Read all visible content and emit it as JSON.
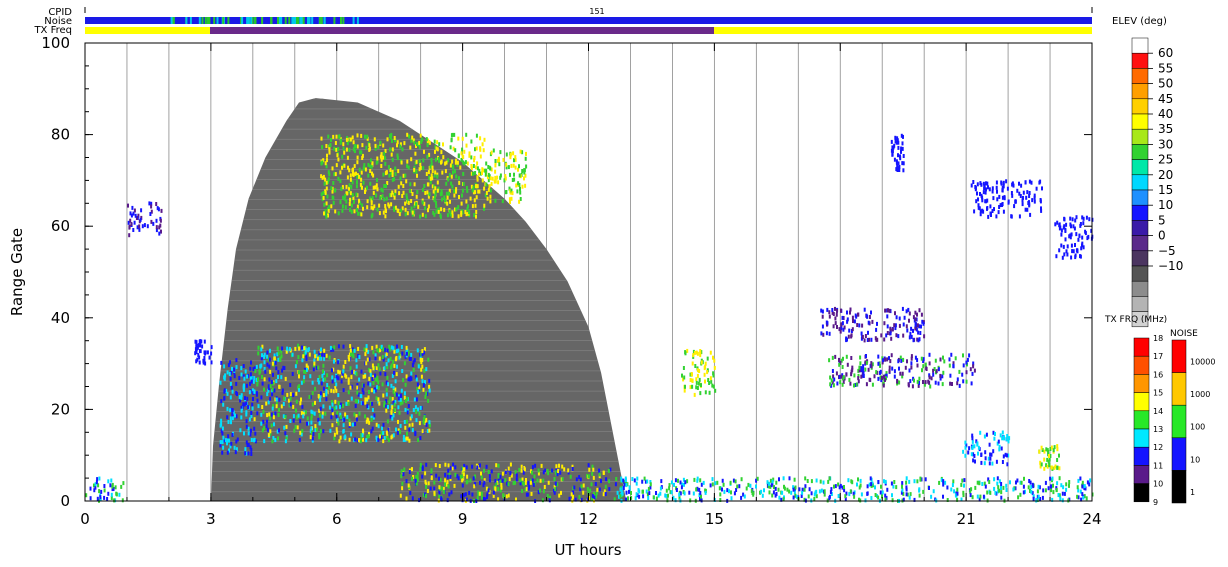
{
  "chart_data": {
    "type": "heatmap",
    "strips": {
      "cpid_label": "CPID",
      "cpid_value": "151",
      "noise_label": "Noise",
      "txfreq_label": "TX Freq",
      "noise_colour": "#1a1ae6",
      "txfreq_colour_default": "#ffff00",
      "txfreq_colour_alt": "#6a2a8a",
      "txfreq_alt_range_hours": [
        3,
        15
      ]
    },
    "xlabel": "UT hours",
    "ylabel": "Range Gate",
    "xlim": [
      0,
      24
    ],
    "ylim": [
      0,
      100
    ],
    "x_ticks": [
      "0",
      "3",
      "6",
      "9",
      "12",
      "15",
      "18",
      "21",
      "24"
    ],
    "x_tick_values": [
      0,
      3,
      6,
      9,
      12,
      15,
      18,
      21,
      24
    ],
    "y_ticks": [
      "0",
      "20",
      "40",
      "60",
      "80",
      "100"
    ],
    "y_tick_values": [
      0,
      20,
      40,
      60,
      80,
      100
    ],
    "vertical_grid_hours": [
      1,
      2,
      3,
      4,
      5,
      6,
      7,
      8,
      9,
      10,
      11,
      12,
      13,
      14,
      15,
      16,
      17,
      18,
      19,
      20,
      21,
      22,
      23
    ],
    "ground_scatter_colour": "#666666",
    "ground_scatter_envelope": [
      [
        3.0,
        0
      ],
      [
        3.05,
        12
      ],
      [
        3.2,
        26
      ],
      [
        3.4,
        42
      ],
      [
        3.6,
        55
      ],
      [
        3.9,
        66
      ],
      [
        4.3,
        75
      ],
      [
        4.8,
        83
      ],
      [
        5.1,
        87
      ],
      [
        5.5,
        88
      ],
      [
        6.0,
        87.5
      ],
      [
        6.5,
        87
      ],
      [
        7.0,
        85
      ],
      [
        7.5,
        83
      ],
      [
        8.0,
        80
      ],
      [
        8.5,
        77
      ],
      [
        9.0,
        74
      ],
      [
        9.5,
        70
      ],
      [
        10.0,
        66
      ],
      [
        10.5,
        61
      ],
      [
        11.0,
        55
      ],
      [
        11.5,
        48
      ],
      [
        12.0,
        38
      ],
      [
        12.3,
        28
      ],
      [
        12.6,
        14
      ],
      [
        12.9,
        0
      ]
    ],
    "scatter_regions": [
      {
        "x": [
          0.0,
          0.9
        ],
        "y": [
          0,
          5
        ],
        "colours": [
          "cyan",
          "green",
          "blue"
        ]
      },
      {
        "x": [
          3.2,
          4.0
        ],
        "y": [
          10,
          31
        ],
        "colours": [
          "cyan",
          "blue"
        ]
      },
      {
        "x": [
          4.0,
          8.2
        ],
        "y": [
          13,
          34
        ],
        "colours": [
          "cyan",
          "blue",
          "yellow",
          "green"
        ]
      },
      {
        "x": [
          5.6,
          9.5
        ],
        "y": [
          62,
          80
        ],
        "colours": [
          "green",
          "yellow"
        ]
      },
      {
        "x": [
          9.5,
          10.5
        ],
        "y": [
          65,
          77
        ],
        "colours": [
          "green",
          "yellow"
        ]
      },
      {
        "x": [
          1.0,
          1.8
        ],
        "y": [
          58,
          65
        ],
        "colours": [
          "blue",
          "purple"
        ]
      },
      {
        "x": [
          2.6,
          3.0
        ],
        "y": [
          30,
          35
        ],
        "colours": [
          "blue"
        ]
      },
      {
        "x": [
          14.2,
          15.0
        ],
        "y": [
          23,
          33
        ],
        "colours": [
          "green",
          "yellow"
        ]
      },
      {
        "x": [
          17.5,
          20.0
        ],
        "y": [
          35,
          42
        ],
        "colours": [
          "blue",
          "purple"
        ]
      },
      {
        "x": [
          17.7,
          21.2
        ],
        "y": [
          25,
          32
        ],
        "colours": [
          "purple",
          "green",
          "blue"
        ]
      },
      {
        "x": [
          19.2,
          19.5
        ],
        "y": [
          72,
          80
        ],
        "colours": [
          "blue"
        ]
      },
      {
        "x": [
          21.1,
          22.8
        ],
        "y": [
          62,
          70
        ],
        "colours": [
          "blue"
        ]
      },
      {
        "x": [
          23.1,
          24.0
        ],
        "y": [
          53,
          62
        ],
        "colours": [
          "blue"
        ]
      },
      {
        "x": [
          20.9,
          22.0
        ],
        "y": [
          8,
          15
        ],
        "colours": [
          "blue",
          "cyan"
        ]
      },
      {
        "x": [
          22.7,
          23.2
        ],
        "y": [
          7,
          12
        ],
        "colours": [
          "green",
          "yellow"
        ]
      },
      {
        "x": [
          12.6,
          24.0
        ],
        "y": [
          0,
          5
        ],
        "colours": [
          "cyan",
          "blue",
          "green"
        ]
      },
      {
        "x": [
          7.5,
          12.5
        ],
        "y": [
          0,
          8
        ],
        "colours": [
          "green",
          "yellow",
          "blue"
        ]
      }
    ],
    "elev_colourbar": {
      "title": "ELEV (deg)",
      "labels": [
        "60",
        "55",
        "50",
        "45",
        "40",
        "35",
        "30",
        "25",
        "20",
        "15",
        "10",
        "5",
        "0",
        "−10"
      ],
      "colours": [
        "#ffffff",
        "#ff1111",
        "#ff6a00",
        "#ff9f00",
        "#ffd000",
        "#ffff00",
        "#a8e81a",
        "#32d232",
        "#00e8a8",
        "#00d8ff",
        "#1e90ff",
        "#1414ff",
        "#3a1aa8",
        "#5a2a8a",
        "#4b3560",
        "#555555",
        "#8c8c8c",
        "#b4b4b4",
        "#d2d2d2"
      ],
      "tick_labels": [
        "60",
        "55",
        "50",
        "45",
        "40",
        "35",
        "30",
        "25",
        "20",
        "15",
        "10",
        "5",
        "0",
        "−5",
        "−10"
      ]
    },
    "txfrq_colourbar": {
      "title": "TX FRQ (MHz)",
      "tick_labels": [
        "18",
        "17",
        "16",
        "15",
        "14",
        "13",
        "12",
        "11",
        "10",
        "9"
      ],
      "colours": [
        "#ff0000",
        "#ff5000",
        "#ff9600",
        "#ffff00",
        "#28e828",
        "#00e8ff",
        "#1414ff",
        "#5a1a8a",
        "#000000"
      ]
    },
    "noise_colourbar": {
      "title": "NOISE",
      "tick_labels": [
        "10000",
        "1000",
        "100",
        "10",
        "1"
      ],
      "colours": [
        "#ff0000",
        "#ffc800",
        "#28e828",
        "#1414ff",
        "#000000"
      ]
    }
  }
}
